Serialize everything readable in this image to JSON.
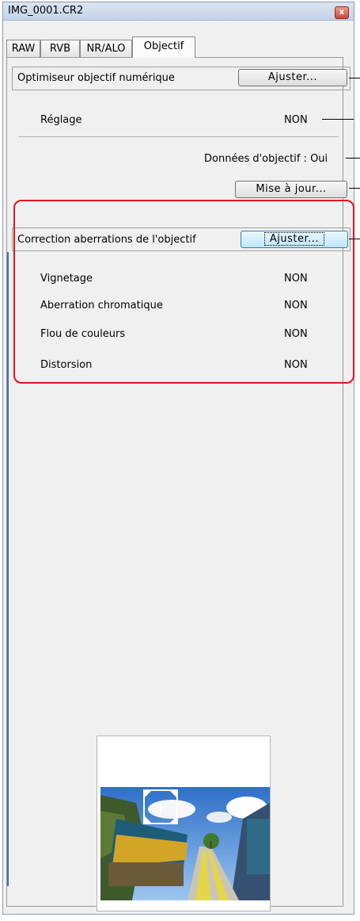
{
  "window": {
    "title": "IMG_0001.CR2",
    "close_glyph": "x"
  },
  "tabs": [
    {
      "label": "RAW"
    },
    {
      "label": "RVB"
    },
    {
      "label": "NR/ALO"
    },
    {
      "label": "Objectif"
    }
  ],
  "active_tab": "Objectif",
  "optimizer": {
    "label": "Optimiseur objectif numérique",
    "adjust_label": "Ajuster...",
    "setting_label": "Réglage",
    "setting_value": "NON",
    "lens_data_label": "Données d'objectif : Oui",
    "update_label": "Mise à jour..."
  },
  "aberration": {
    "label": "Correction aberrations de l'objectif",
    "adjust_label": "Ajuster...",
    "rows": [
      {
        "label": "Vignetage",
        "value": "NON"
      },
      {
        "label": "Aberration chromatique",
        "value": "NON"
      },
      {
        "label": "Flou de couleurs",
        "value": "NON"
      },
      {
        "label": "Distorsion",
        "value": "NON"
      }
    ]
  },
  "colors": {
    "highlight": "#e0141e",
    "accent": "#3c6bb7"
  },
  "preview": {
    "icon": "move-crosshair-icon"
  }
}
